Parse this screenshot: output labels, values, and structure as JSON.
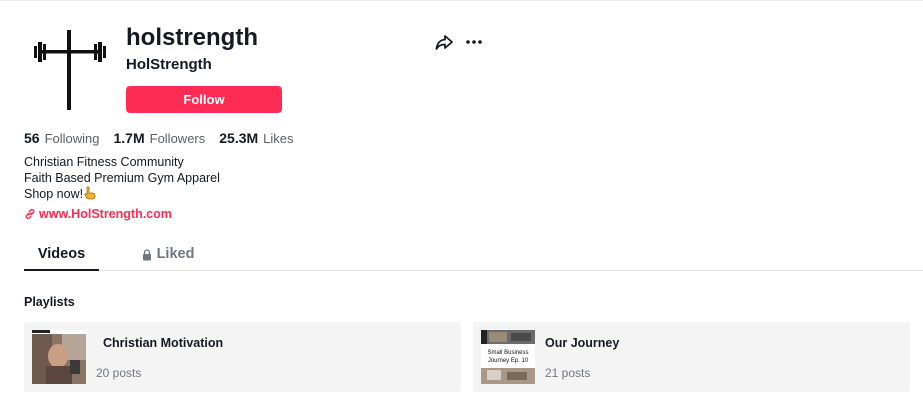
{
  "profile": {
    "username": "holstrength",
    "nickname": "HolStrength",
    "follow_label": "Follow",
    "avatar_icon": "cross-barbell-icon"
  },
  "stats": [
    {
      "value": "56",
      "label": "Following"
    },
    {
      "value": "1.7M",
      "label": "Followers"
    },
    {
      "value": "25.3M",
      "label": "Likes"
    }
  ],
  "bio": {
    "line1": "Christian Fitness Community",
    "line2": "Faith Based Premium Gym Apparel",
    "line3": "Shop now!",
    "line3_emoji": "pointing-down-hand-icon"
  },
  "link": {
    "text": "www.HolStrength.com",
    "icon": "link-icon"
  },
  "tabs": [
    {
      "label": "Videos",
      "active": true
    },
    {
      "label": "Liked",
      "active": false,
      "icon": "lock-icon"
    }
  ],
  "playlists": {
    "title": "Playlists",
    "items": [
      {
        "title": "Christian Motivation",
        "count": "20 posts"
      },
      {
        "title": "Our Journey",
        "count": "21 posts",
        "thumb_text_line1": "Small Business",
        "thumb_text_line2": "Journey Ep. 10"
      }
    ]
  },
  "colors": {
    "accent": "#fe2c55",
    "text": "#161823",
    "muted": "#73757d",
    "card_bg": "#f4f4f4"
  }
}
